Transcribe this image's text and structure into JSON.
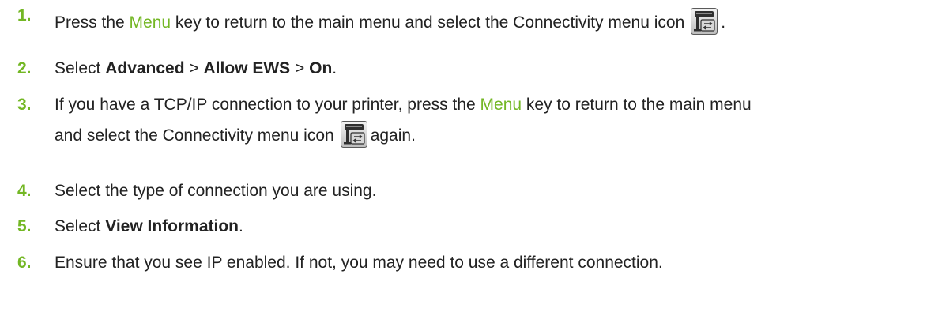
{
  "steps": [
    {
      "number": "1.",
      "before": "Press the ",
      "key": "Menu",
      "after": " key to return to the main menu and select the Connectivity menu icon",
      "trail": "."
    },
    {
      "number": "2.",
      "select": "Select ",
      "opt1": "Advanced",
      "sep1": " > ",
      "opt2": "Allow EWS",
      "sep2": " > ",
      "opt3": "On",
      "end": "."
    },
    {
      "number": "3.",
      "before": "If you have a TCP/IP connection to your printer, press the ",
      "key": "Menu",
      "after": " key to return to the main menu",
      "line2": "and select the Connectivity menu icon",
      "trail": "again."
    },
    {
      "number": "4.",
      "text": "Select the type of connection you are using."
    },
    {
      "number": "5.",
      "select": "Select ",
      "opt": "View Information",
      "end": "."
    },
    {
      "number": "6.",
      "text": "Ensure that you see IP enabled. If not, you may need to use a different connection."
    }
  ],
  "icons": {
    "connectivity": "connectivity-menu-icon"
  },
  "colors": {
    "accent": "#73b724",
    "text": "#222222"
  }
}
